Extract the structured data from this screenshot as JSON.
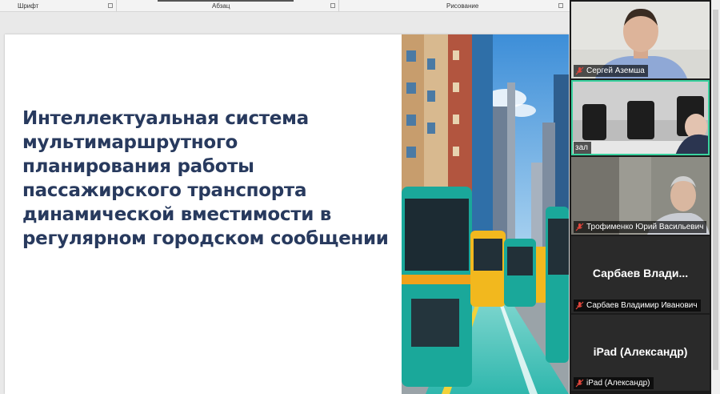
{
  "ribbon": {
    "groups": [
      {
        "label": "Шрифт"
      },
      {
        "label": "Абзац"
      },
      {
        "label": "Рисование"
      }
    ]
  },
  "slide": {
    "title": "Интеллектуальная система мультимаршрутного планирования работы пассажирского транспорта динамической вместимости в регулярном городском сообщении"
  },
  "participants": [
    {
      "name": "Сергей Аземша",
      "muted": true,
      "video": true
    },
    {
      "name": "зал",
      "muted": false,
      "video": true,
      "active": true
    },
    {
      "name": "Трофименко Юрий Васильевич",
      "muted": true,
      "video": true
    },
    {
      "name": "Сарбаев Владимир Иванович",
      "display": "Сарбаев  Влади...",
      "muted": true,
      "video": false
    },
    {
      "name": "iPad (Александр)",
      "display": "iPad (Александр)",
      "muted": true,
      "video": false
    }
  ],
  "colors": {
    "title": "#283a5e",
    "active_border": "#3ad29f",
    "muted_icon": "#e0463c",
    "panel_bg": "#1b1b1b",
    "tile_bg": "#2a2a2a"
  }
}
